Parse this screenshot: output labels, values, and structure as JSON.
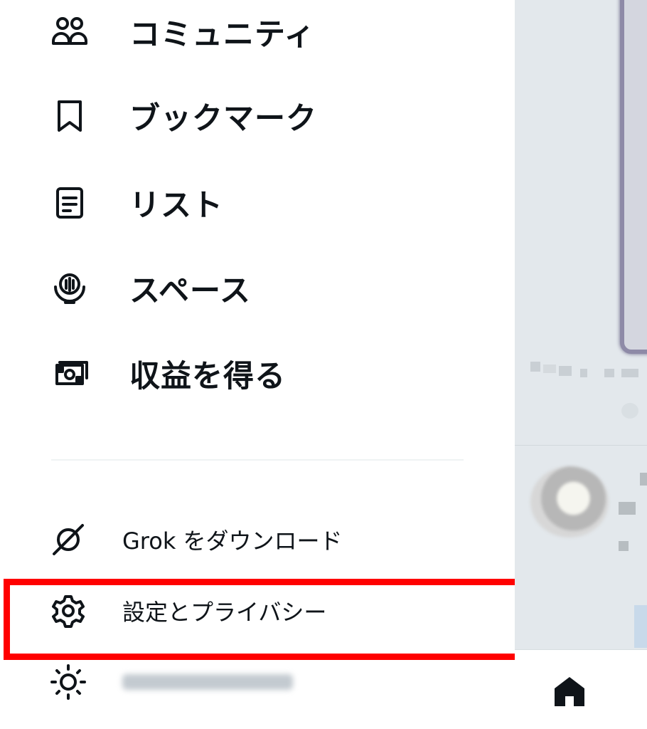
{
  "drawer": {
    "main_items": [
      {
        "label": "コミュニティ",
        "icon": "communities-icon"
      },
      {
        "label": "ブックマーク",
        "icon": "bookmark-icon"
      },
      {
        "label": "リスト",
        "icon": "list-icon"
      },
      {
        "label": "スペース",
        "icon": "spaces-icon"
      },
      {
        "label": "収益を得る",
        "icon": "monetization-icon"
      }
    ],
    "secondary_items": [
      {
        "label": "Grok をダウンロード",
        "icon": "grok-icon"
      },
      {
        "label": "設定とプライバシー",
        "icon": "gear-icon"
      },
      {
        "label": "",
        "icon": "sun-icon"
      }
    ]
  },
  "bottom_nav": {
    "home_icon": "home-icon"
  },
  "colors": {
    "text": "#0f1419",
    "highlight_border": "#ff0000",
    "backdrop": "#e3e8ec"
  }
}
